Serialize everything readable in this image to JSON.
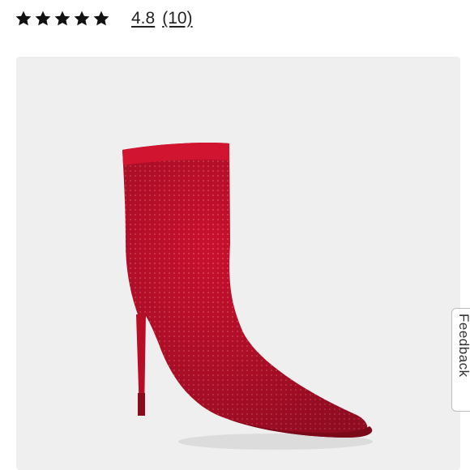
{
  "rating": {
    "stars_filled": 5,
    "stars_total": 5,
    "value": "4.8",
    "review_count": "(10)"
  },
  "product_image": {
    "icon": "red-ankle-boot-image",
    "colors": {
      "boot": "#c8102e",
      "background": "#f0efef"
    }
  },
  "feedback_tab": {
    "label": "Feedback"
  }
}
